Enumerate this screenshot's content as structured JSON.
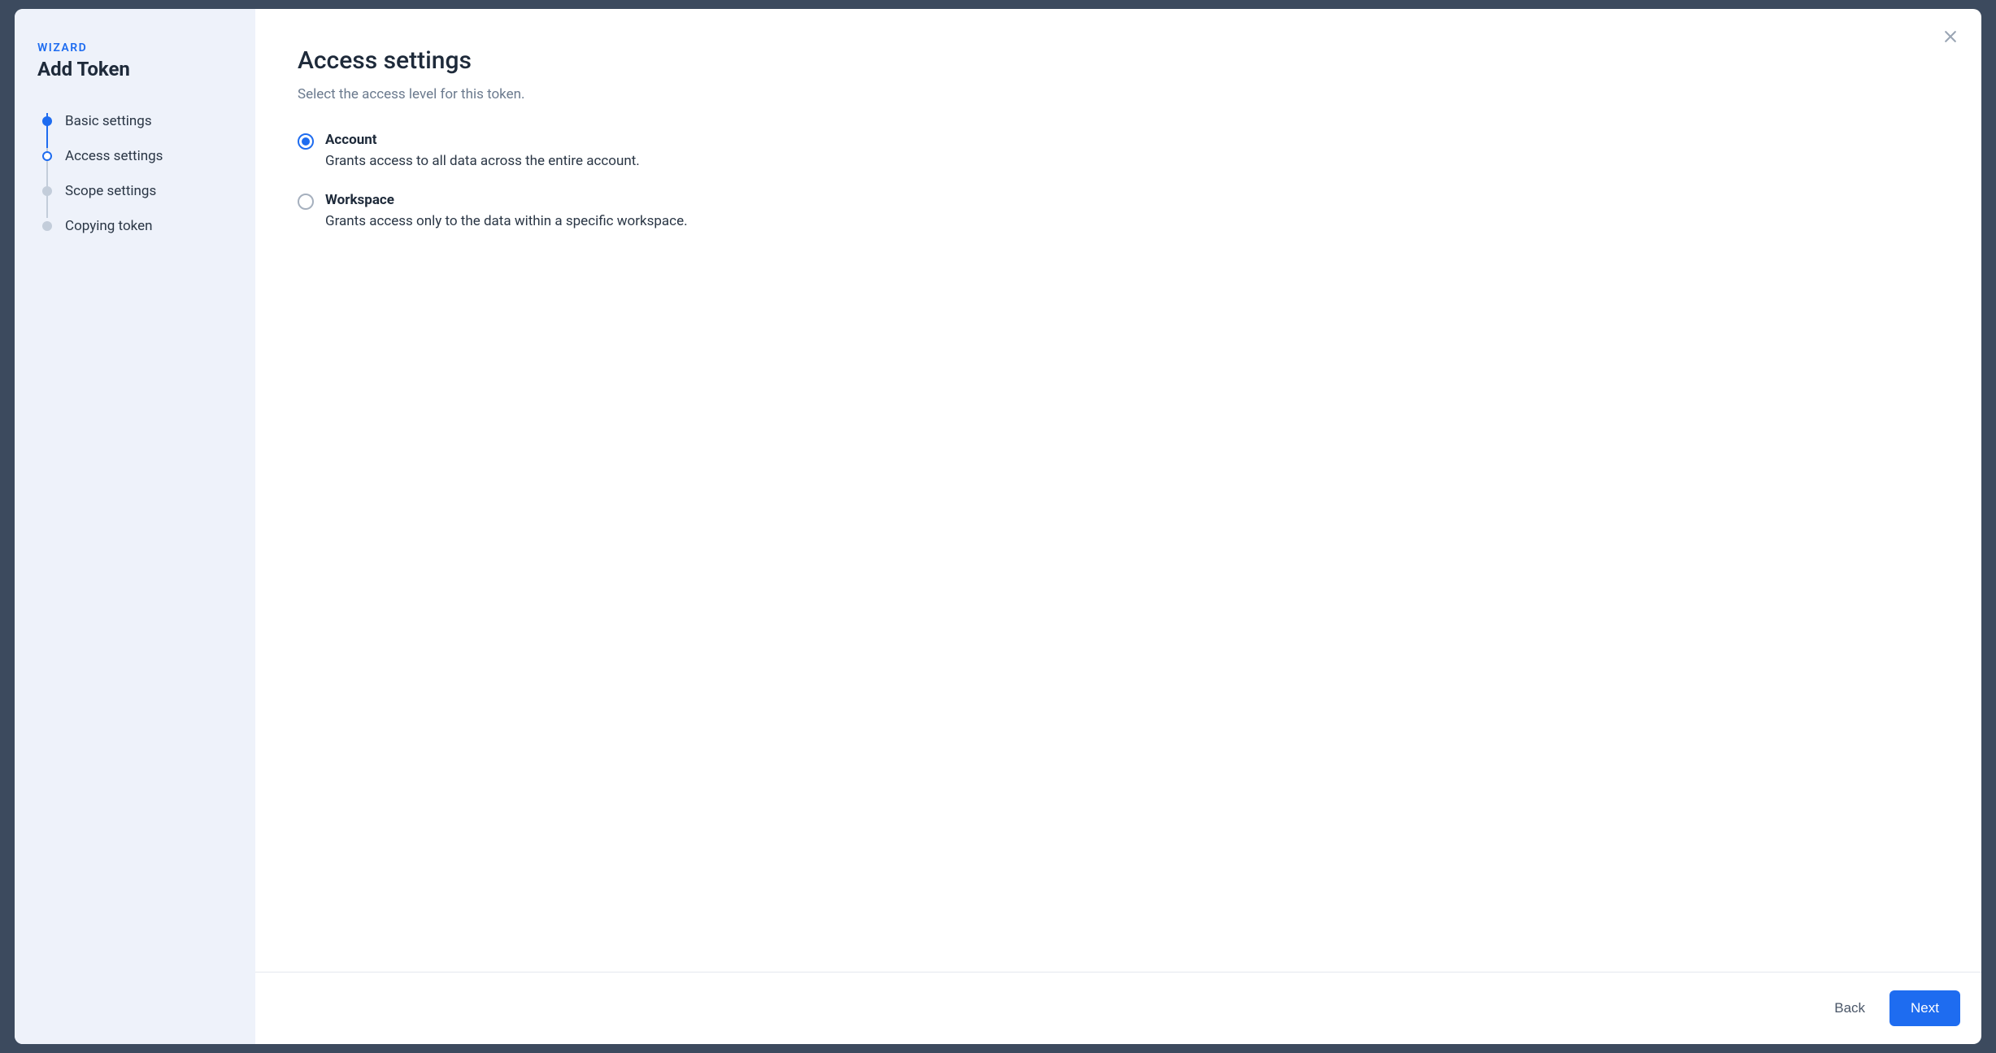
{
  "sidebar": {
    "wizard_label": "WIZARD",
    "title": "Add Token",
    "steps": [
      {
        "label": "Basic settings",
        "state": "done"
      },
      {
        "label": "Access settings",
        "state": "current"
      },
      {
        "label": "Scope settings",
        "state": "pending"
      },
      {
        "label": "Copying token",
        "state": "pending"
      }
    ]
  },
  "main": {
    "title": "Access settings",
    "subtitle": "Select the access level for this token.",
    "options": [
      {
        "key": "account",
        "label": "Account",
        "description": "Grants access to all data across the entire account.",
        "selected": true
      },
      {
        "key": "workspace",
        "label": "Workspace",
        "description": "Grants access only to the data within a specific workspace.",
        "selected": false
      }
    ]
  },
  "footer": {
    "back_label": "Back",
    "next_label": "Next"
  }
}
